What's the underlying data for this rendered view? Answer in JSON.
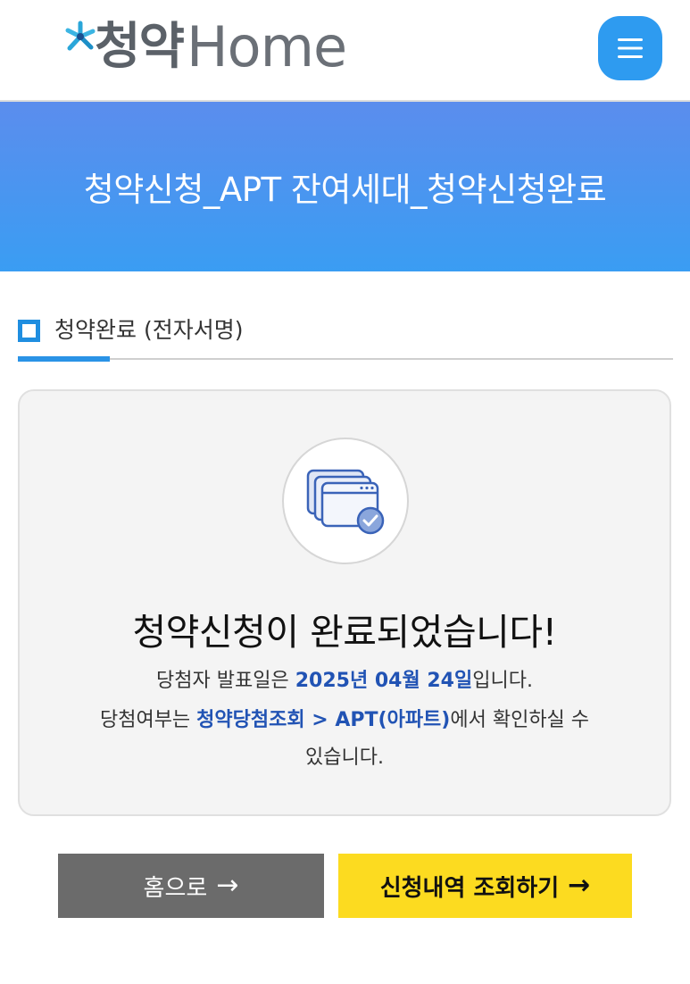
{
  "header": {
    "logo_ko": "청약",
    "logo_en": "Home",
    "menu_icon": "hamburger-menu-icon"
  },
  "banner": {
    "title": "청약신청_APT 잔여세대_청약신청완료"
  },
  "section": {
    "title": "청약완료 (전자서명)"
  },
  "card": {
    "icon": "completed-application-check-icon",
    "headline": "청약신청이 완료되었습니다!",
    "line1_prefix": "당첨자 발표일은 ",
    "announcement_date": "2025년 04월 24일",
    "line1_suffix": "입니다.",
    "line2_prefix": "당첨여부는 ",
    "line2_link": "청약당첨조회 > APT(아파트)",
    "line2_suffix": "에서 확인하실 수",
    "line3": "있습니다."
  },
  "buttons": {
    "home_label": "홈으로",
    "history_label": "신청내역 조회하기",
    "arrow": "→"
  },
  "colors": {
    "accent_blue": "#2e9bf0",
    "banner_start": "#5b8ded",
    "banner_end": "#3a9df3",
    "highlight_text": "#2153b4",
    "home_button": "#6b6b6b",
    "history_button": "#fcdb20"
  }
}
